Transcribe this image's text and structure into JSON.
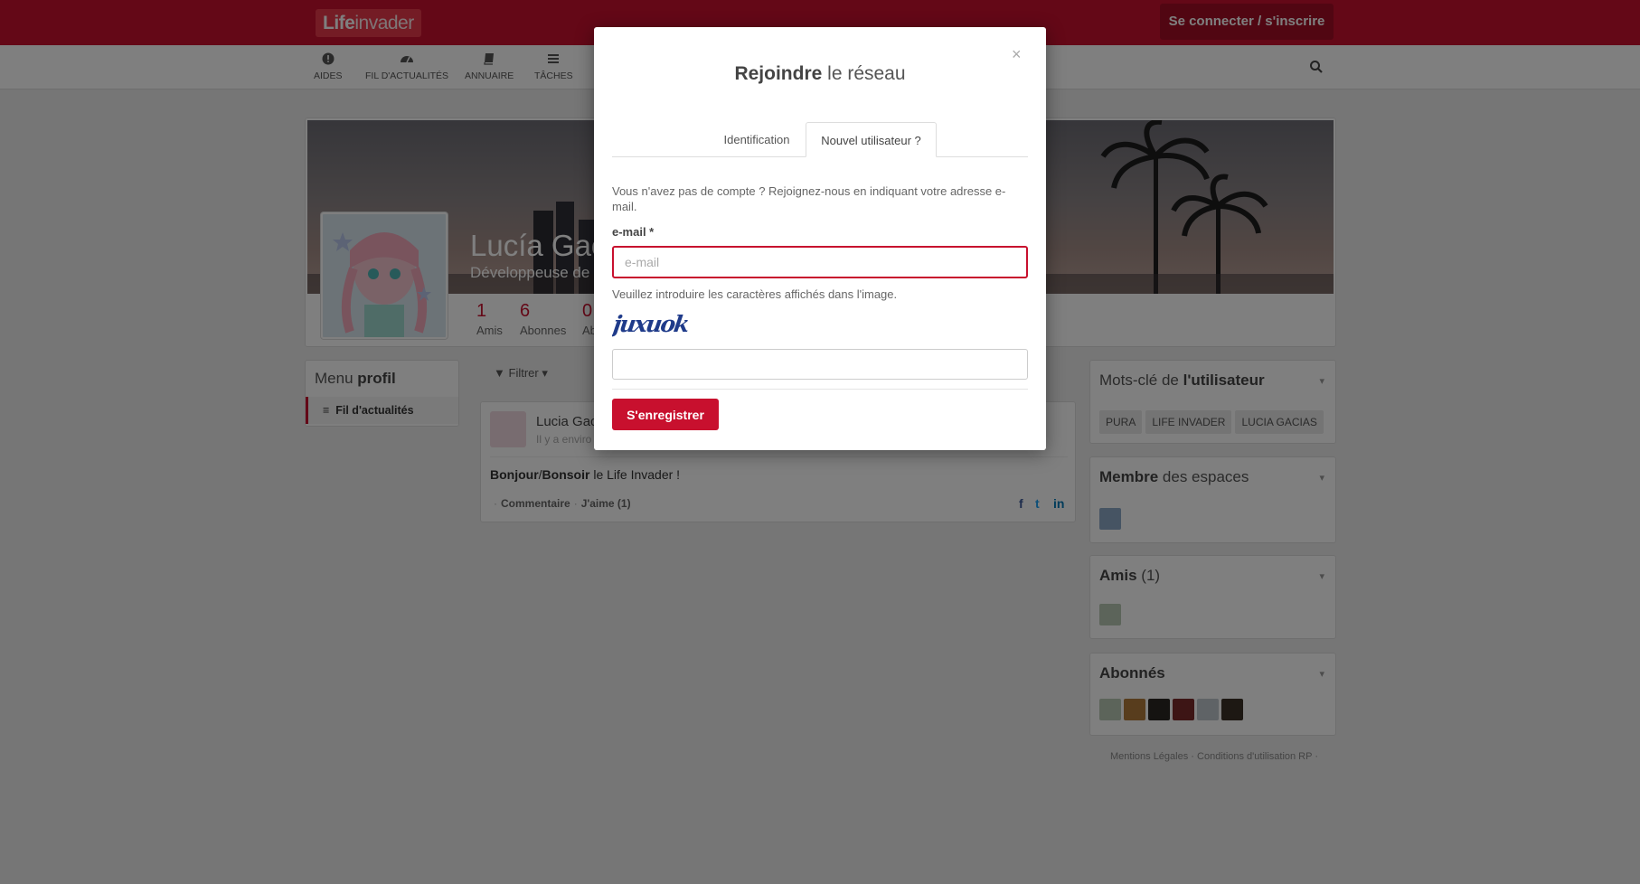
{
  "header": {
    "logo_bold": "Life",
    "logo_light": "invader",
    "login_label": "Se connecter / s'inscrire",
    "brand_color": "#c8102e"
  },
  "nav": {
    "items": [
      {
        "label": "AIDES",
        "icon": "exclamation-circle-icon"
      },
      {
        "label": "FIL D'ACTUALITÉS",
        "icon": "dashboard-icon"
      },
      {
        "label": "ANNUAIRE",
        "icon": "book-icon"
      },
      {
        "label": "TÂCHES",
        "icon": "tasks-icon"
      }
    ],
    "search_icon": "search-icon"
  },
  "profile": {
    "name": "Lucía Gací",
    "role": "Développeuse de L",
    "stats": [
      {
        "value": "1",
        "label": "Amis"
      },
      {
        "value": "6",
        "label": "Abonnes"
      },
      {
        "value": "0",
        "label": "Ab"
      }
    ]
  },
  "menu": {
    "title_light": "Menu",
    "title_bold": "profil",
    "items": [
      {
        "label": "Fil d'actualités",
        "icon": "list-icon"
      }
    ]
  },
  "stream": {
    "filter_label": "Filtrer",
    "post": {
      "author": "Lucia Gaci",
      "time": "Il y a enviro",
      "text_b1": "Bonjour",
      "text_sep": "/",
      "text_b2": "Bonsoir",
      "text_rest": " le Life Invader !",
      "comment_label": "Commentaire",
      "like_label": "J'aime (1)"
    }
  },
  "sidebar": {
    "keywords": {
      "title_light": "Mots-clé de ",
      "title_bold": "l'utilisateur",
      "tags": [
        "PURA",
        "LIFE INVADER",
        "LUCIA GACIAS"
      ]
    },
    "spaces": {
      "title_bold": "Membre",
      "title_light": " des espaces"
    },
    "friends": {
      "title_bold": "Amis",
      "title_light": " (1)"
    },
    "followers": {
      "title_bold": "Abonnés"
    }
  },
  "footer": {
    "legal": "Mentions Légales",
    "terms": "Conditions d'utilisation RP"
  },
  "modal": {
    "title_bold": "Rejoindre",
    "title_light": " le réseau",
    "close": "×",
    "tabs": [
      {
        "label": "Identification",
        "active": false
      },
      {
        "label": "Nouvel utilisateur ?",
        "active": true
      }
    ],
    "help_text": "Vous n'avez pas de compte ? Rejoignez-nous en indiquant votre adresse e-mail.",
    "email_label": "e-mail *",
    "email_placeholder": "e-mail",
    "email_value": "",
    "captcha_hint": "Veuillez introduire les caractères affichés dans l'image.",
    "captcha_text": "juxuok",
    "captcha_value": "",
    "submit_label": "S'enregistrer"
  }
}
